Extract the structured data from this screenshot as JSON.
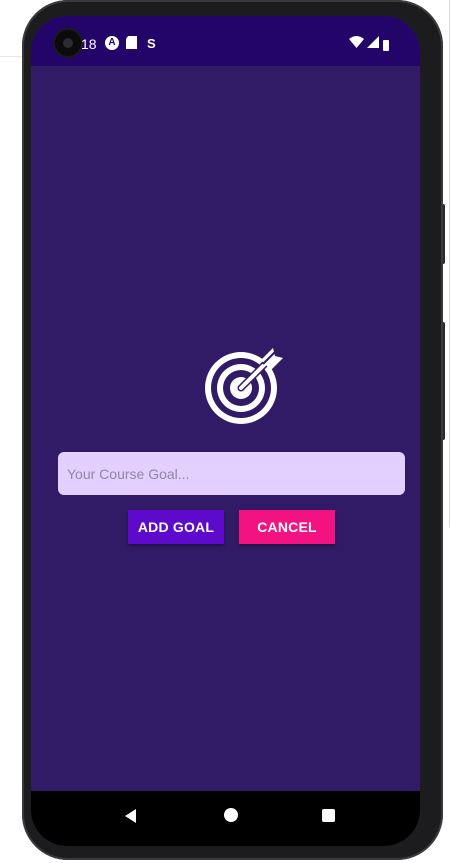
{
  "status_bar": {
    "time": "18",
    "notifications": [
      "A",
      "S"
    ],
    "icons": [
      "camera-icon",
      "notification-a-icon",
      "sd-card-icon",
      "notification-s-icon",
      "wifi-icon",
      "signal-icon",
      "battery-icon"
    ]
  },
  "goal_input": {
    "placeholder": "Your Course Goal...",
    "value": ""
  },
  "actions": {
    "add_label": "Add Goal",
    "cancel_label": "Cancel"
  },
  "nav": {
    "icons": [
      "back-icon",
      "home-icon",
      "recents-icon"
    ]
  },
  "colors": {
    "background": "#311b67",
    "status_bar": "#23056a",
    "input_background": "#e4d0ff",
    "add_button": "#5e0acc",
    "cancel_button": "#f31282"
  }
}
